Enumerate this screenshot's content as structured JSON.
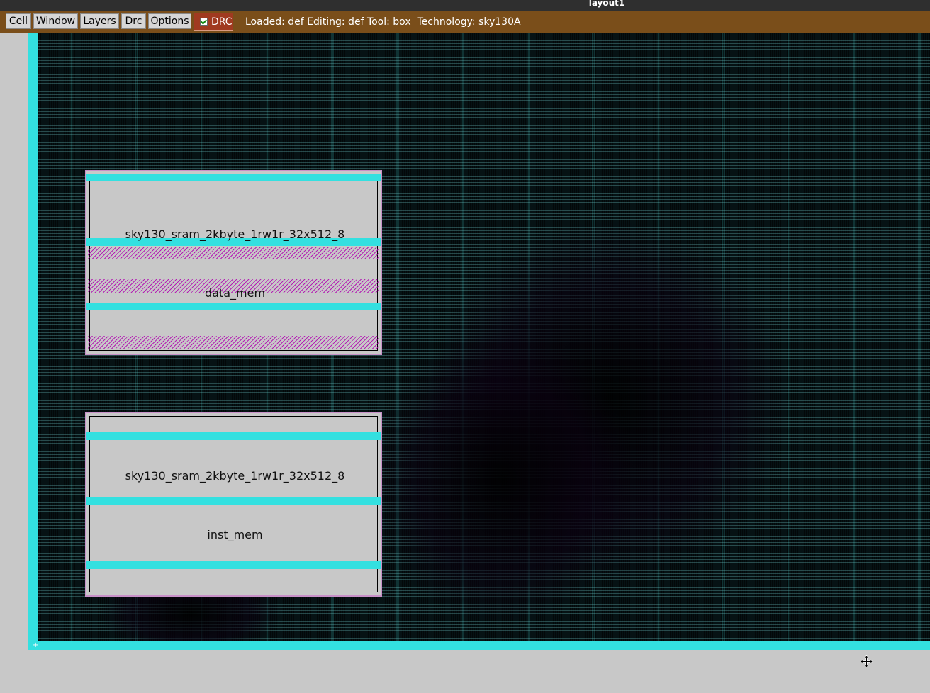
{
  "window": {
    "title": "layout1"
  },
  "menu": {
    "items": [
      {
        "label": "Cell"
      },
      {
        "label": "Window"
      },
      {
        "label": "Layers"
      },
      {
        "label": "Drc"
      },
      {
        "label": "Options"
      }
    ],
    "drc_toggle": {
      "label": "DRC",
      "checked": true
    }
  },
  "status": {
    "text": "Loaded: def Editing: def Tool: box  Technology: sky130A"
  },
  "layout": {
    "macros": [
      {
        "cell": "sky130_sram_2kbyte_1rw1r_32x512_8",
        "instance": "data_mem"
      },
      {
        "cell": "sky130_sram_2kbyte_1rw1r_32x512_8",
        "instance": "inst_mem"
      }
    ]
  },
  "colors": {
    "menubar": "#7a4e1a",
    "drc_button": "#a03a20",
    "canvas_bg": "#061214",
    "boundary_cyan": "#33e0e0",
    "macro_fill": "#c8c8c8",
    "hatch_magenta": "#b000b0"
  },
  "icons": {
    "drc_checkbox": "checkmark-icon",
    "pointer": "move-cursor-icon"
  }
}
